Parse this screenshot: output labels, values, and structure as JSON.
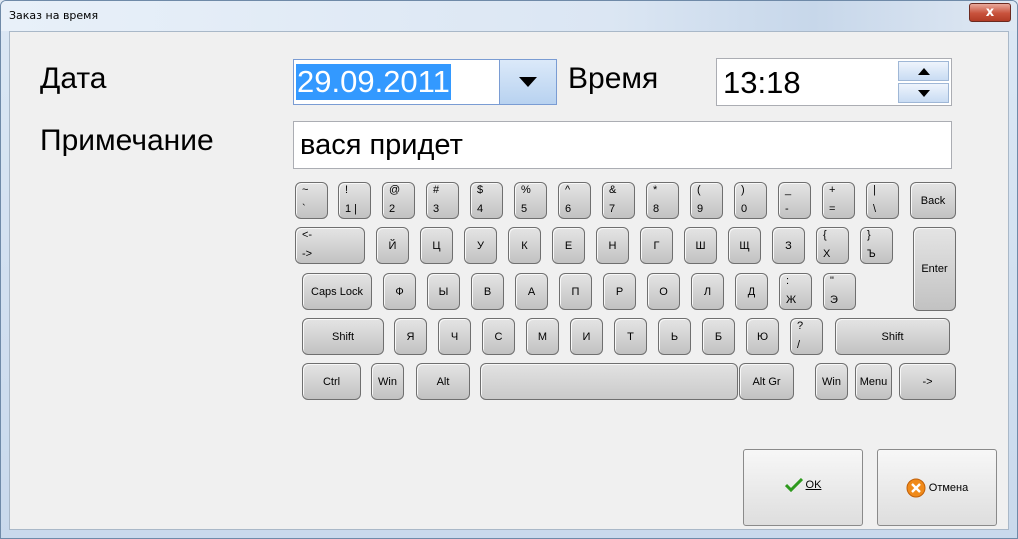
{
  "window": {
    "title": "Заказ на время",
    "close_glyph": "x"
  },
  "form": {
    "date_label": "Дата",
    "date_value": "29.09.2011",
    "time_label": "Время",
    "time_value": "13:18",
    "note_label": "Примечание",
    "note_value": "вася придет"
  },
  "keyboard": {
    "row1": [
      {
        "top": "~",
        "bot": "`"
      },
      {
        "top": "!",
        "bot": "1 |"
      },
      {
        "top": "@",
        "bot": "2"
      },
      {
        "top": "#",
        "bot": "3"
      },
      {
        "top": "$",
        "bot": "4"
      },
      {
        "top": "%",
        "bot": "5"
      },
      {
        "top": "^",
        "bot": "6"
      },
      {
        "top": "&",
        "bot": "7"
      },
      {
        "top": "*",
        "bot": "8"
      },
      {
        "top": "(",
        "bot": "9"
      },
      {
        "top": ")",
        "bot": "0"
      },
      {
        "top": "_",
        "bot": "-"
      },
      {
        "top": "+",
        "bot": "="
      },
      {
        "top": "|",
        "bot": "\\"
      }
    ],
    "back": "Back",
    "tab": {
      "top": "<-",
      "bot": "->"
    },
    "row2": [
      "Й",
      "Ц",
      "У",
      "К",
      "Е",
      "Н",
      "Г",
      "Ш",
      "Щ",
      "З"
    ],
    "row2_extra": [
      {
        "top": "{",
        "bot": "Х"
      },
      {
        "top": "}",
        "bot": "Ъ"
      }
    ],
    "enter": "Enter",
    "caps": "Caps Lock",
    "row3": [
      "Ф",
      "Ы",
      "В",
      "А",
      "П",
      "Р",
      "О",
      "Л",
      "Д"
    ],
    "row3_extra": [
      {
        "top": ":",
        "bot": "Ж"
      },
      {
        "top": "\"",
        "bot": "Э"
      }
    ],
    "shift_left": "Shift",
    "row4": [
      "Я",
      "Ч",
      "С",
      "М",
      "И",
      "Т",
      "Ь",
      "Б",
      "Ю"
    ],
    "row4_extra": {
      "top": "?",
      "bot": "/"
    },
    "shift_right": "Shift",
    "ctrl": "Ctrl",
    "win_left": "Win",
    "alt": "Alt",
    "altgr": "Alt Gr",
    "win_right": "Win",
    "menu": "Menu",
    "arrow": "->"
  },
  "buttons": {
    "ok_label": "OK",
    "ok_icon": "checkmark-icon",
    "ok_color": "#2e9a1e",
    "cancel_label": "Отмена",
    "cancel_icon": "cancel-icon",
    "cancel_color": "#f08a1a"
  }
}
